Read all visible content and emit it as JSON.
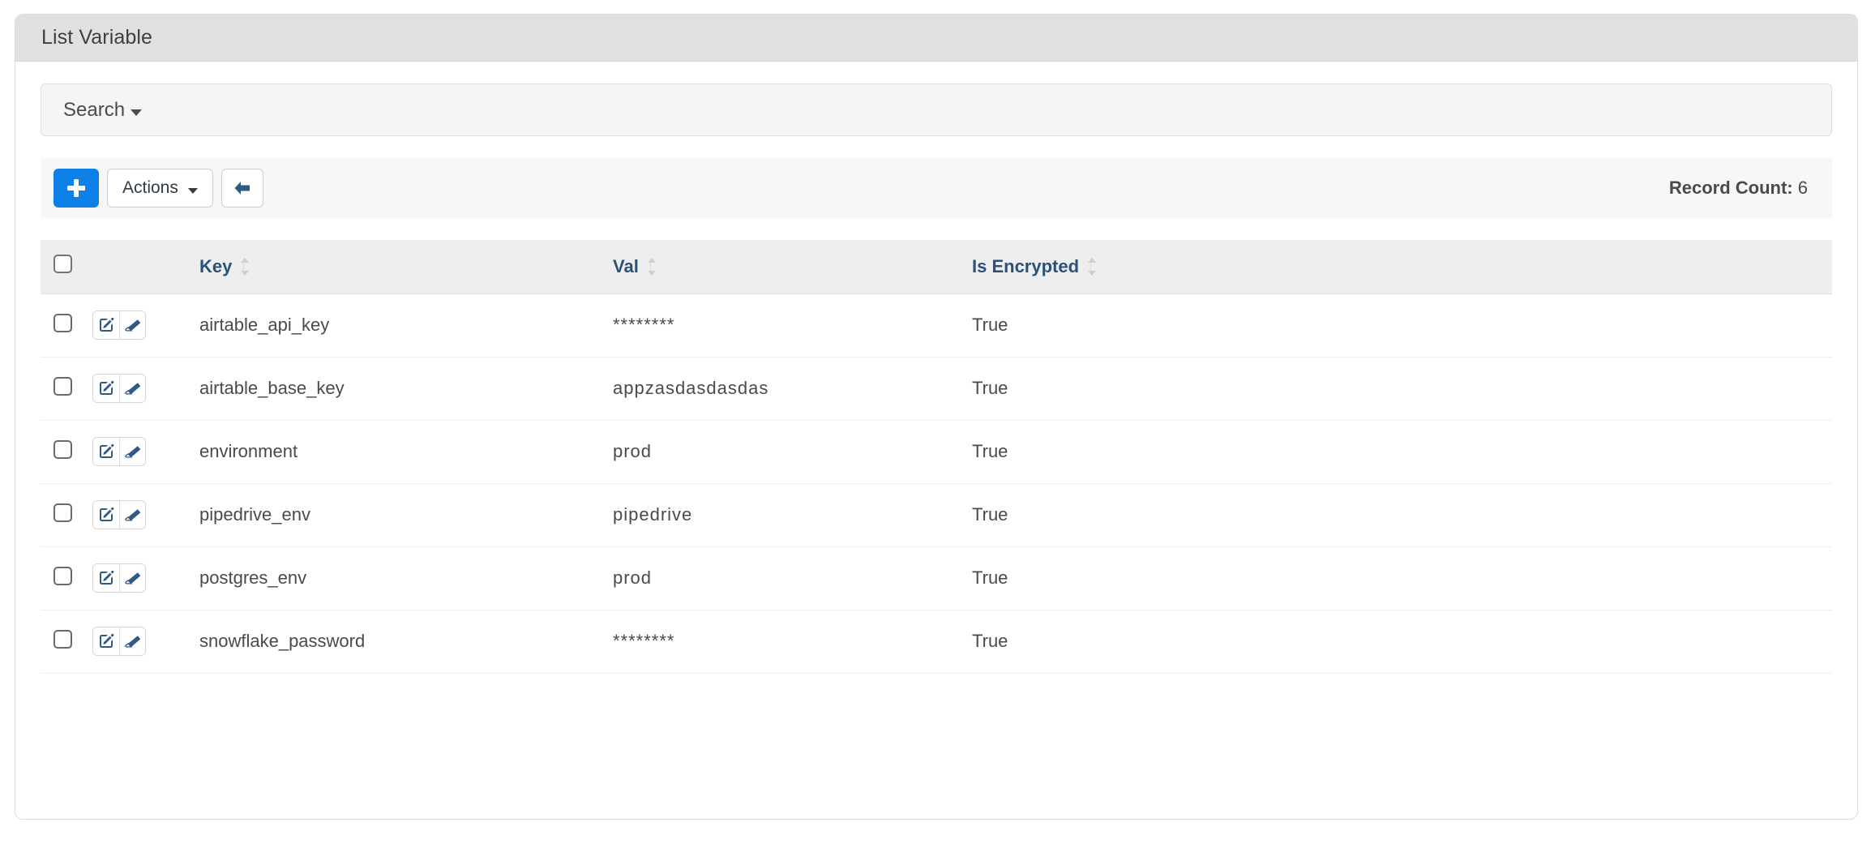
{
  "card": {
    "title": "List Variable"
  },
  "search": {
    "label": "Search",
    "caret_icon": "caret-down-icon"
  },
  "toolbar": {
    "add_label": "",
    "add_icon": "plus-icon",
    "actions_label": "Actions",
    "actions_caret_icon": "caret-down-icon",
    "back_icon": "arrow-left-icon",
    "record_count_label": "Record Count:",
    "record_count_value": "6"
  },
  "table": {
    "select_all_icon": "checkbox-unchecked-icon",
    "sort_icon": "sort-updown-icon",
    "row_edit_icon": "edit-pencil-square-icon",
    "row_erase_icon": "eraser-icon",
    "columns": [
      {
        "key": "check",
        "label": ""
      },
      {
        "key": "actions",
        "label": ""
      },
      {
        "key": "key",
        "label": "Key",
        "sortable": true
      },
      {
        "key": "val",
        "label": "Val",
        "sortable": true
      },
      {
        "key": "is_encrypted",
        "label": "Is Encrypted",
        "sortable": true
      }
    ],
    "rows": [
      {
        "key": "airtable_api_key",
        "val": "********",
        "is_encrypted": "True"
      },
      {
        "key": "airtable_base_key",
        "val": "appzasdasdasdas",
        "is_encrypted": "True"
      },
      {
        "key": "environment",
        "val": "prod",
        "is_encrypted": "True"
      },
      {
        "key": "pipedrive_env",
        "val": "pipedrive",
        "is_encrypted": "True"
      },
      {
        "key": "postgres_env",
        "val": "prod",
        "is_encrypted": "True"
      },
      {
        "key": "snowflake_password",
        "val": "********",
        "is_encrypted": "True"
      }
    ]
  },
  "colors": {
    "primary_button": "#0d80e8",
    "header_text": "#2b5179",
    "card_header_bg": "#e0e0e0",
    "icon_slate": "#2f5a84"
  }
}
